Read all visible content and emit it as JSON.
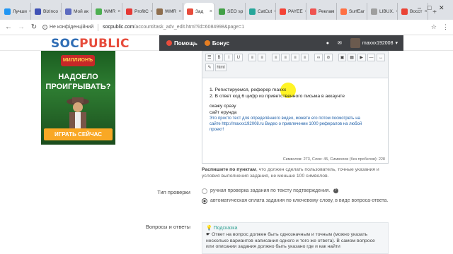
{
  "browser": {
    "tabs": [
      {
        "label": "Лучши",
        "color": "#2196f3",
        "active": false
      },
      {
        "label": "Bizinco",
        "color": "#3f51b5",
        "active": false
      },
      {
        "label": "Мой ак",
        "color": "#5c6bc0",
        "active": false
      },
      {
        "label": "WMR",
        "color": "#4caf50",
        "active": false
      },
      {
        "label": "ProfitC",
        "color": "#e53935",
        "active": false
      },
      {
        "label": "WMR",
        "color": "#8e6e4e",
        "active": false
      },
      {
        "label": "Зад",
        "color": "#e74c3c",
        "active": true
      },
      {
        "label": "SEO sp",
        "color": "#43a047",
        "active": false
      },
      {
        "label": "CatCut",
        "color": "#26a69a",
        "active": false
      },
      {
        "label": "PAYEE",
        "color": "#f44336",
        "active": false
      },
      {
        "label": "Реклам",
        "color": "#ef5350",
        "active": false
      },
      {
        "label": "SurfEar",
        "color": "#ff7043",
        "active": false
      },
      {
        "label": "LIBUX.",
        "color": "#9e9e9e",
        "active": false
      },
      {
        "label": "Восст",
        "color": "#ea4335",
        "active": false
      }
    ],
    "security_label": "Не конфіденційний",
    "url_host": "socpublic.com",
    "url_path": "/account/task_adv_edit.html?id=6084998&page=1"
  },
  "site": {
    "logo_part1": "SOC",
    "logo_part2": "PUBLIC",
    "nav_help": "Помощь",
    "nav_bonus": "Бонус",
    "username": "maxxx192008"
  },
  "ad": {
    "brand": "МИЛЛИОНЪ",
    "headline_line1": "НАДОЕЛО",
    "headline_line2": "ПРОИГРЫВАТЬ?",
    "button": "ИГРАТЬ СЕЙЧАС"
  },
  "editor": {
    "html_button": "html",
    "line1": "1. Регистируемся, реферер maxxx",
    "line2": "2. В ответ код 6 цифр из приветственного письма в аккаунте",
    "line3": "скажу сразу",
    "line4": "сайт ерунда",
    "para1": "Это просто тест для определённого видео, можете его потом посмотреть на",
    "para2": "сайте http://maxxx192008.ru Видео о привлечении 1000 рефералов на любой",
    "para3": "проект!",
    "counter": "Символов: 273, Слов: 45, Символов (без пробелов): 228"
  },
  "hint": {
    "bold": "Распишите по пунктам",
    "rest": ", что должен сделать пользователь, точные указания и условия выполнения задания, не меньше 100 символов."
  },
  "check_type": {
    "label": "Тип проверки",
    "option_manual": "ручная проверка задания по тексту подтверждения.",
    "option_auto": "автоматическая оплата задания по ключевому слову, в виде вопроса-ответа."
  },
  "qa": {
    "label": "Вопросы и ответы",
    "hint_title": "Подсказка",
    "hint_text": "Ответ на вопрос должен быть однозначным и точным (можно указать несколько вариантов написания одного и того же ответа). В самом вопросе или описании задания должно быть указано где и как найти"
  }
}
